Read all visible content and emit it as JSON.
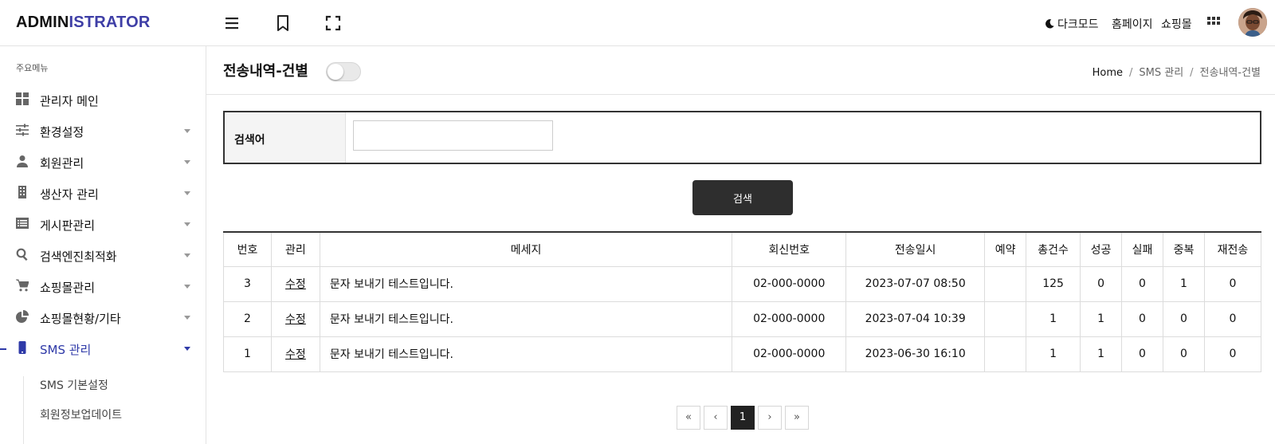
{
  "header": {
    "logo_part1": "ADMIN",
    "logo_part2": "ISTRATOR",
    "dark_mode_label": "다크모드",
    "homepage_label": "홈페이지",
    "shop_label": "쇼핑몰"
  },
  "sidebar": {
    "section_title": "주요메뉴",
    "items": [
      {
        "label": "관리자 메인",
        "icon": "dashboard-icon"
      },
      {
        "label": "환경설정",
        "icon": "sliders-icon"
      },
      {
        "label": "회원관리",
        "icon": "person-icon"
      },
      {
        "label": "생산자 관리",
        "icon": "building-icon"
      },
      {
        "label": "게시판관리",
        "icon": "list-icon"
      },
      {
        "label": "검색엔진최적화",
        "icon": "search-icon"
      },
      {
        "label": "쇼핑몰관리",
        "icon": "cart-icon"
      },
      {
        "label": "쇼핑몰현황/기타",
        "icon": "pie-chart-icon"
      },
      {
        "label": "SMS 관리",
        "icon": "phone-icon",
        "active": true
      }
    ],
    "sub_items": [
      "SMS 기본설정",
      "회원정보업데이트"
    ]
  },
  "page": {
    "title": "전송내역-건별",
    "breadcrumb": [
      "Home",
      "SMS 관리",
      "전송내역-건별"
    ]
  },
  "search": {
    "label": "검색어",
    "value": "",
    "button_label": "검색"
  },
  "table": {
    "headers": [
      "번호",
      "관리",
      "메세지",
      "회신번호",
      "전송일시",
      "예약",
      "총건수",
      "성공",
      "실패",
      "중복",
      "재전송"
    ],
    "rows": [
      {
        "no": "3",
        "action": "수정",
        "message": "문자 보내기 테스트입니다.",
        "reply": "02-000-0000",
        "sent_at": "2023-07-07 08:50",
        "reserved": "",
        "total": "125",
        "success": "0",
        "fail": "0",
        "dup": "1",
        "resend": "0"
      },
      {
        "no": "2",
        "action": "수정",
        "message": "문자 보내기 테스트입니다.",
        "reply": "02-000-0000",
        "sent_at": "2023-07-04 10:39",
        "reserved": "",
        "total": "1",
        "success": "1",
        "fail": "0",
        "dup": "0",
        "resend": "0"
      },
      {
        "no": "1",
        "action": "수정",
        "message": "문자 보내기 테스트입니다.",
        "reply": "02-000-0000",
        "sent_at": "2023-06-30 16:10",
        "reserved": "",
        "total": "1",
        "success": "1",
        "fail": "0",
        "dup": "0",
        "resend": "0"
      }
    ]
  },
  "pagination": {
    "first": "«",
    "prev": "‹",
    "current": "1",
    "next": "›",
    "last": "»"
  },
  "colors": {
    "accent": "#2f3aa8",
    "logo_accent": "#3e3ea6",
    "button_dark": "#2e2e2e"
  }
}
